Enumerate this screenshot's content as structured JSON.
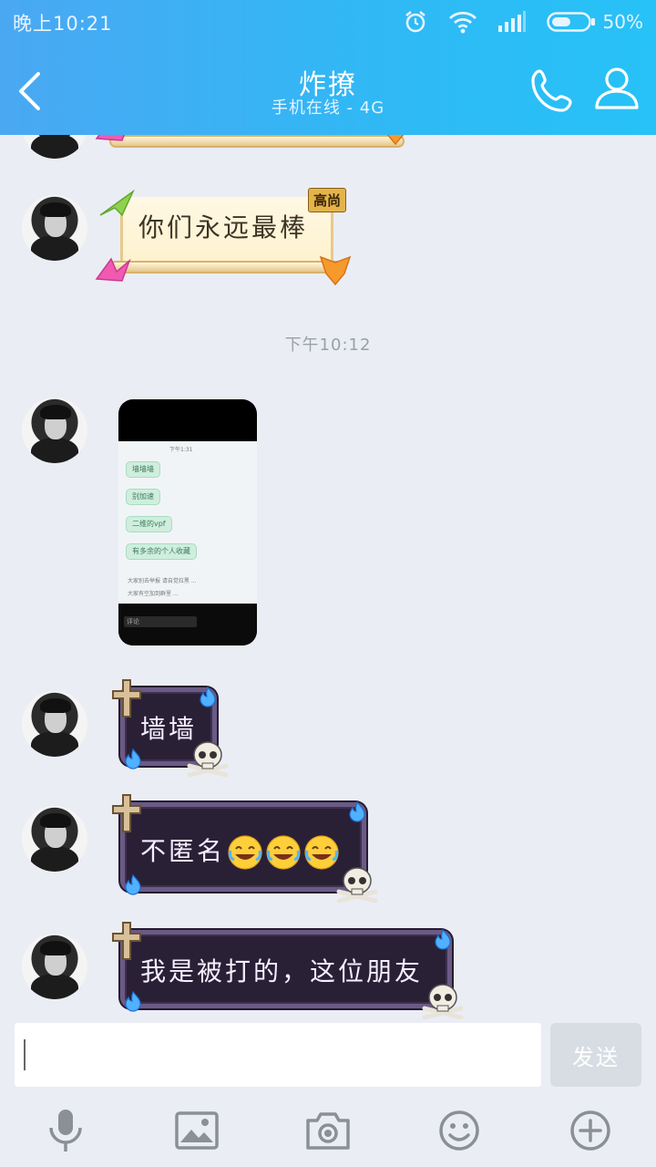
{
  "status_bar": {
    "time": "晚上10:21",
    "battery": "50%"
  },
  "header": {
    "title": "炸撩",
    "subtitle": "手机在线 - 4G"
  },
  "messages": {
    "text_1": "你们永远最棒",
    "tag_1": "高尚",
    "time_divider": "下午10:12",
    "image_preview": {
      "header_time": "下午1:31",
      "chips": [
        "墙墙墙",
        "别加速",
        "二维的vpf",
        "有多余的个人收藏"
      ],
      "lines": [
        "大家别去举报 请自觉拉黑 ...",
        "大家有空加到群里 ..."
      ],
      "input_placeholder": "评论"
    },
    "text_2": "墙墙",
    "text_3": "不匿名",
    "text_4": "我是被打的，这位朋友"
  },
  "input": {
    "value": "",
    "send_label": "发送"
  },
  "toolbar": {
    "icons": [
      "microphone-icon",
      "image-icon",
      "camera-icon",
      "emoji-icon",
      "plus-icon"
    ]
  },
  "colors": {
    "header_start": "#4aa8f3",
    "header_end": "#27c2f7",
    "background": "#ebedf5",
    "gothic_bubble": "#2a2036",
    "send_disabled": "#d8dde3"
  }
}
